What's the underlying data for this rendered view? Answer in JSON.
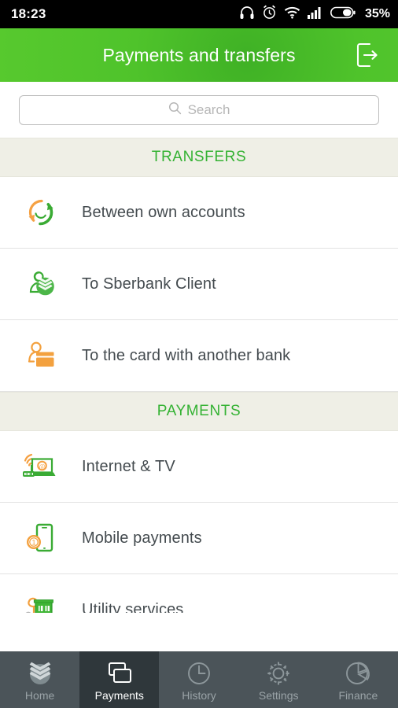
{
  "status_bar": {
    "time": "18:23",
    "battery_percent": "35%",
    "icons": [
      "headphones-icon",
      "alarm-clock-icon",
      "wifi-icon",
      "cellular-signal-icon",
      "battery-icon"
    ]
  },
  "header": {
    "title": "Payments and transfers",
    "exit_icon": "exit-logout-icon",
    "background_color": "#4fc32b"
  },
  "search": {
    "placeholder": "Search",
    "value": "",
    "icon": "search-icon"
  },
  "sections": [
    {
      "title": "TRANSFERS",
      "items": [
        {
          "label": "Between own accounts",
          "icon": "circular-arrows-icon"
        },
        {
          "label": "To Sberbank Client",
          "icon": "person-sberbank-logo-icon"
        },
        {
          "label": "To the card with another bank",
          "icon": "person-card-icon"
        }
      ]
    },
    {
      "title": "PAYMENTS",
      "items": [
        {
          "label": "Internet & TV",
          "icon": "laptop-wifi-at-icon"
        },
        {
          "label": "Mobile payments",
          "icon": "phone-coin-icon"
        },
        {
          "label": "Utility services",
          "icon": "building-tree-icon"
        }
      ]
    }
  ],
  "bottom_nav": {
    "active": "Payments",
    "items": [
      {
        "label": "Home",
        "icon": "sberbank-logo-icon"
      },
      {
        "label": "Payments",
        "icon": "cards-stack-icon"
      },
      {
        "label": "History",
        "icon": "clock-icon"
      },
      {
        "label": "Settings",
        "icon": "gear-icon"
      },
      {
        "label": "Finance",
        "icon": "pie-chart-icon"
      }
    ]
  },
  "colors": {
    "brand_green": "#34b233",
    "accent_orange": "#f59a28",
    "section_bg": "#efefe6",
    "nav_bg": "#4b5459",
    "nav_active_bg": "#2f373b"
  }
}
